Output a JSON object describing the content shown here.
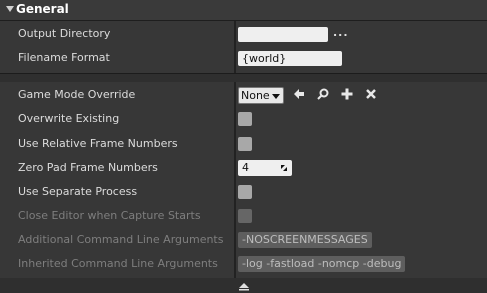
{
  "section": {
    "title": "General"
  },
  "output_directory": {
    "label": "Output Directory",
    "value": "",
    "browse_label": "..."
  },
  "filename_format": {
    "label": "Filename Format",
    "value": "{world}"
  },
  "game_mode_override": {
    "label": "Game Mode Override",
    "value": "None"
  },
  "overwrite_existing": {
    "label": "Overwrite Existing",
    "checked": false
  },
  "use_relative_frame_numbers": {
    "label": "Use Relative Frame Numbers",
    "checked": false
  },
  "zero_pad_frame_numbers": {
    "label": "Zero Pad Frame Numbers",
    "value": "4"
  },
  "use_separate_process": {
    "label": "Use Separate Process",
    "checked": false
  },
  "close_editor_when_capture_starts": {
    "label": "Close Editor when Capture Starts",
    "checked": false
  },
  "additional_command_line_arguments": {
    "label": "Additional Command Line Arguments",
    "value": "-NOSCREENMESSAGES"
  },
  "inherited_command_line_arguments": {
    "label": "Inherited Command Line Arguments",
    "value": "-log -fastload -nomcp -debug"
  },
  "icons": {
    "collapse": "triangle-down-icon",
    "use_selected": "arrow-left-icon",
    "browse": "magnifier-icon",
    "add": "plus-icon",
    "clear": "x-icon",
    "spin_grip": "resize-grip-icon",
    "advanced_toggle": "chevron-up-icon"
  }
}
